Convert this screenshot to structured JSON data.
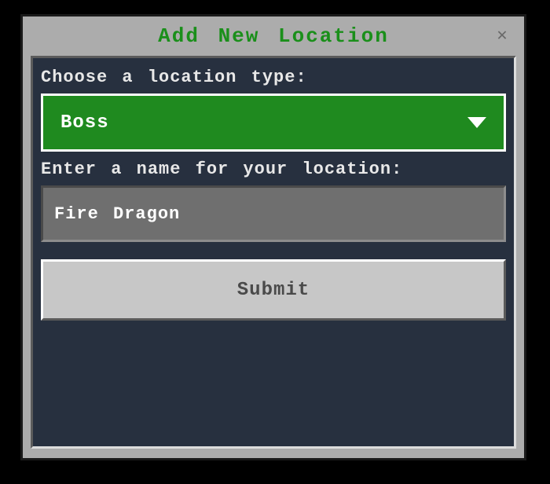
{
  "window": {
    "title": "Add New Location",
    "close_symbol": "✕"
  },
  "form": {
    "type_label": "Choose a location type:",
    "type_selected": "Boss",
    "name_label": "Enter a name for your location:",
    "name_value": "Fire Dragon",
    "submit_label": "Submit"
  }
}
